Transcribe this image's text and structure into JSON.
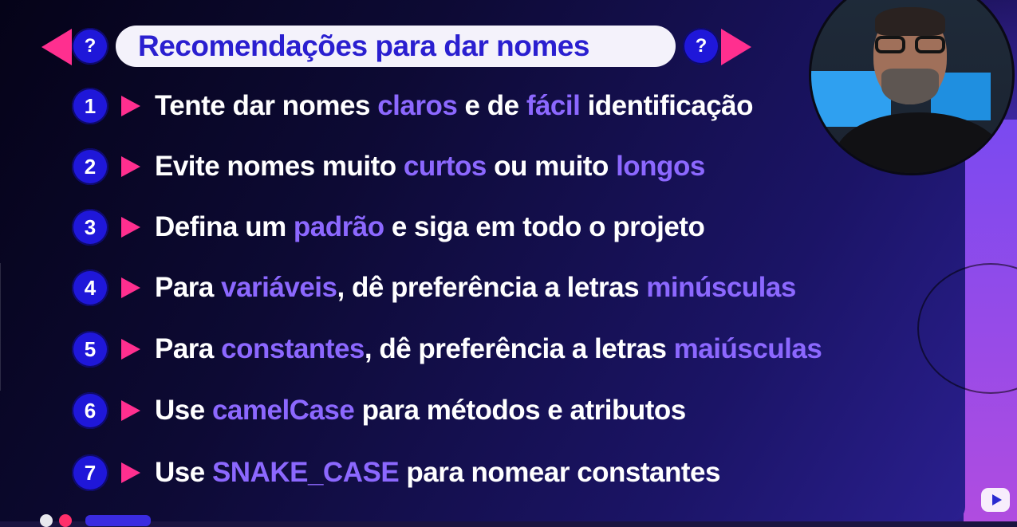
{
  "header": {
    "title": "Recomendações para dar nomes",
    "help_left": "?",
    "help_right": "?"
  },
  "items": [
    {
      "num": "1",
      "parts": [
        {
          "t": "Tente dar nomes "
        },
        {
          "t": "claros",
          "hl": true
        },
        {
          "t": " e de "
        },
        {
          "t": "fácil",
          "hl": true
        },
        {
          "t": " identificação"
        }
      ]
    },
    {
      "num": "2",
      "parts": [
        {
          "t": "Evite nomes muito "
        },
        {
          "t": "curtos",
          "hl": true
        },
        {
          "t": " ou muito "
        },
        {
          "t": "longos",
          "hl": true
        }
      ]
    },
    {
      "num": "3",
      "parts": [
        {
          "t": "Defina um "
        },
        {
          "t": "padrão",
          "hl": true
        },
        {
          "t": " e siga em todo o projeto"
        }
      ]
    },
    {
      "num": "4",
      "parts": [
        {
          "t": "Para "
        },
        {
          "t": "variáveis",
          "hl": true
        },
        {
          "t": ", dê preferência a letras "
        },
        {
          "t": "minúsculas",
          "hl": true
        }
      ]
    },
    {
      "num": "5",
      "parts": [
        {
          "t": "Para "
        },
        {
          "t": "constantes",
          "hl": true
        },
        {
          "t": ", dê preferência a letras "
        },
        {
          "t": "maiúsculas",
          "hl": true
        }
      ]
    },
    {
      "num": "6",
      "parts": [
        {
          "t": "Use "
        },
        {
          "t": "camelCase",
          "hl": true
        },
        {
          "t": " para métodos e atributos"
        }
      ]
    },
    {
      "num": "7",
      "parts": [
        {
          "t": "Use "
        },
        {
          "t": "SNAKE_CASE",
          "hl": true
        },
        {
          "t": " para nomear constantes"
        }
      ]
    }
  ],
  "colors": {
    "accent_pink": "#ff2f8f",
    "badge_blue": "#1f17d9",
    "highlight_purple": "#8c68ff",
    "title_blue": "#2a1fd0"
  },
  "icons": {
    "prev": "triangle-left-icon",
    "next": "triangle-right-icon",
    "help": "question-icon",
    "bullet": "play-arrow-icon",
    "logo": "youtube-icon"
  }
}
